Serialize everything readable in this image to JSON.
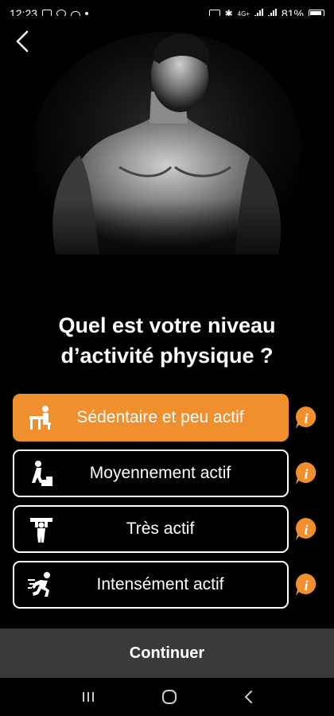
{
  "status_bar": {
    "time": "12:23",
    "battery": "81%",
    "network": "4G+"
  },
  "hero": {
    "image": "shirtless-man-photo"
  },
  "title_lines": [
    "Quel est votre niveau",
    "d’activité physique ?"
  ],
  "options": [
    {
      "label": "Sédentaire et peu actif",
      "icon": "desk-person-icon",
      "selected": true
    },
    {
      "label": "Moyennement actif",
      "icon": "stairs-person-icon",
      "selected": false
    },
    {
      "label": "Très actif",
      "icon": "lifting-person-icon",
      "selected": false
    },
    {
      "label": "Intensément actif",
      "icon": "running-person-icon",
      "selected": false
    }
  ],
  "continue_label": "Continuer",
  "colors": {
    "accent": "#ef8f2e",
    "background": "#000000",
    "continue_bar": "#3a3a3a"
  }
}
